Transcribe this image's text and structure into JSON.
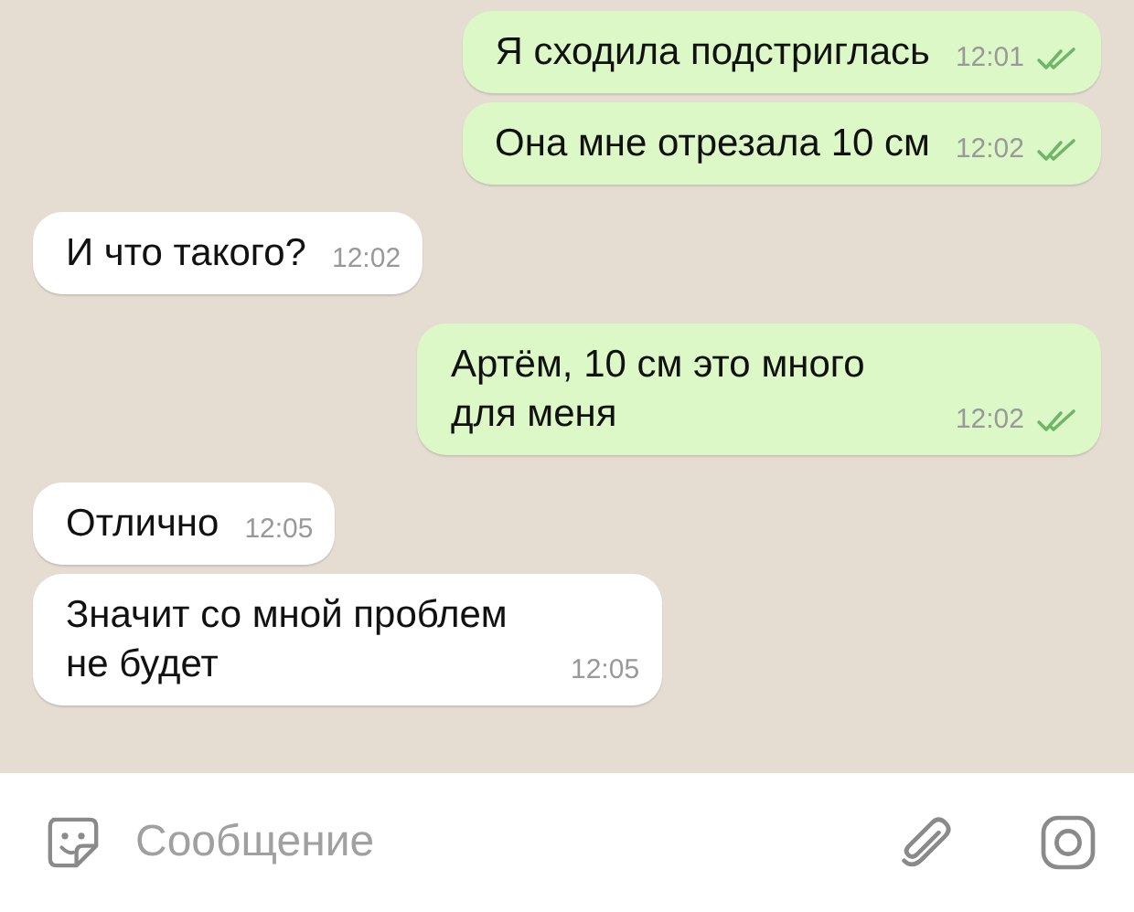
{
  "messages": [
    {
      "outgoing": true,
      "text": "Я сходила подстриглась",
      "time": "12:01",
      "read": true
    },
    {
      "outgoing": true,
      "text": "Она мне отрезала 10 см",
      "time": "12:02",
      "read": true
    },
    {
      "outgoing": false,
      "text": "И что такого?",
      "time": "12:02"
    },
    {
      "outgoing": true,
      "text": "Артём, 10 см это много для меня",
      "time": "12:02",
      "read": true
    },
    {
      "outgoing": false,
      "text": "Отлично",
      "time": "12:05"
    },
    {
      "outgoing": false,
      "text": "Значит со мной проблем не будет",
      "time": "12:05"
    }
  ],
  "composer": {
    "placeholder": "Сообщение"
  }
}
